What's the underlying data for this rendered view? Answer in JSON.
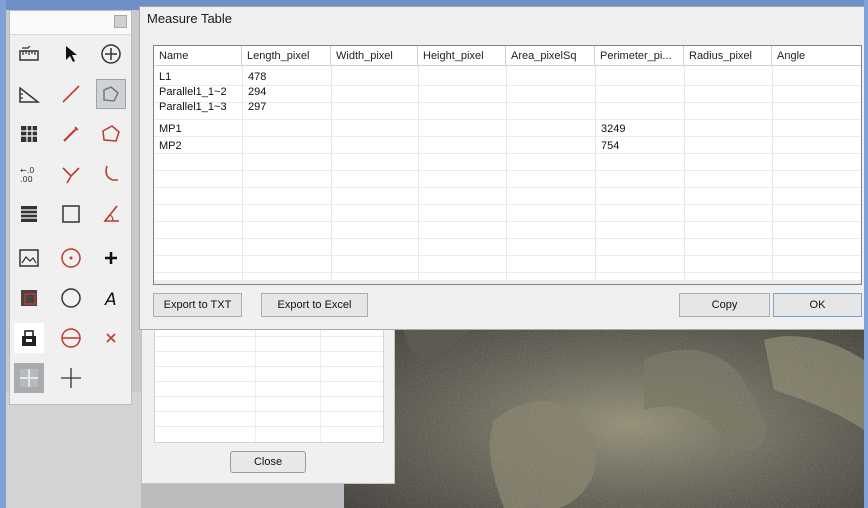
{
  "dialog": {
    "title": "Measure Table",
    "columns": [
      "Name",
      "Length_pixel",
      "Width_pixel",
      "Height_pixel",
      "Area_pixelSq",
      "Perimeter_pi...",
      "Radius_pixel",
      "Angle"
    ],
    "rows": [
      {
        "name": "L1",
        "length": "478",
        "perimeter": ""
      },
      {
        "name": "Parallel1_1~2",
        "length": "294",
        "perimeter": ""
      },
      {
        "name": "Parallel1_1~3",
        "length": "297",
        "perimeter": ""
      },
      {
        "name": "MP1",
        "length": "",
        "perimeter": "3249"
      },
      {
        "name": "MP2",
        "length": "",
        "perimeter": "754"
      }
    ],
    "buttons": {
      "export_txt": "Export to TXT",
      "export_excel": "Export to Excel",
      "copy": "Copy",
      "ok": "OK"
    }
  },
  "secondary_panel": {
    "close_label": "Close"
  },
  "toolbar": {
    "tools": [
      "calibration-ruler-icon",
      "pointer-arrow-icon",
      "crosshair-circle-icon",
      "ruler-icon",
      "line-tool-icon",
      "polyline-tool-icon",
      "table-grid-icon",
      "pencil-line-icon",
      "polygon-tool-icon",
      "decimal-precision-icon",
      "angle-lines-icon",
      "arc-tool-icon",
      "list-table-icon",
      "rectangle-tool-icon",
      "angle-measure-icon",
      "image-view-icon",
      "circle-center-icon",
      "point-plus-icon",
      "crop-icon",
      "circle-tool-icon",
      "text-tool-icon",
      "lock-print-icon",
      "circle-diameter-icon",
      "delete-x-icon",
      "grid-cross-icon",
      "crosshair-line-icon"
    ]
  }
}
